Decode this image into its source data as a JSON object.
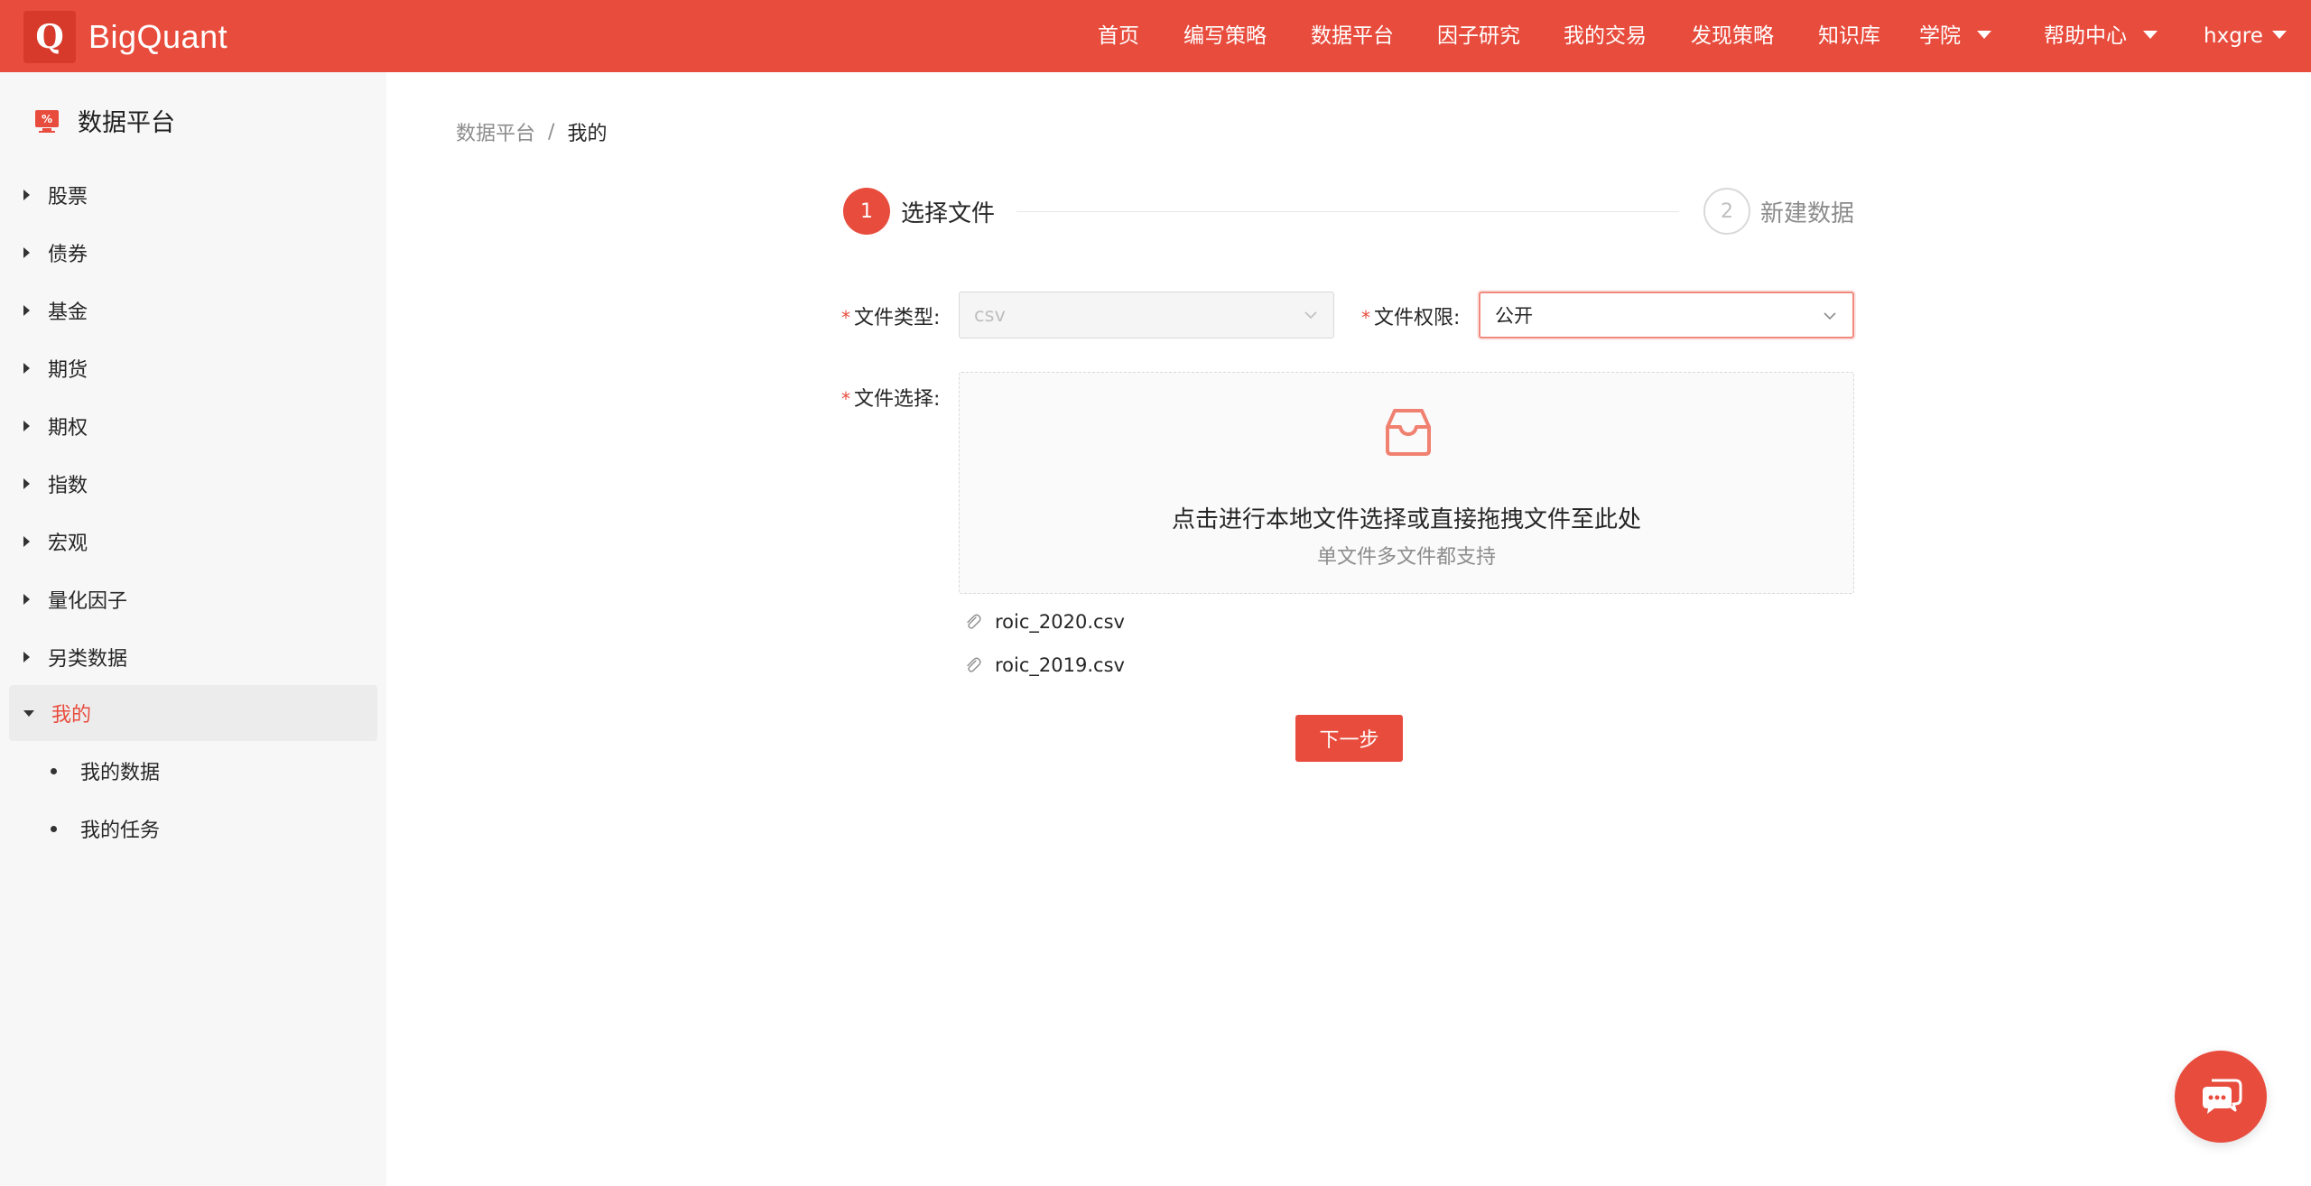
{
  "brand": {
    "logo_letter": "Q",
    "name": "BigQuant"
  },
  "nav": {
    "items": [
      {
        "label": "首页"
      },
      {
        "label": "编写策略"
      },
      {
        "label": "数据平台"
      },
      {
        "label": "因子研究"
      },
      {
        "label": "我的交易"
      },
      {
        "label": "发现策略"
      },
      {
        "label": "知识库"
      },
      {
        "label": "学院",
        "dropdown": true
      },
      {
        "label": "帮助中心",
        "dropdown": true
      },
      {
        "label": "hxgre",
        "dropdown": true
      }
    ]
  },
  "sidebar": {
    "title": "数据平台",
    "items": [
      {
        "label": "股票"
      },
      {
        "label": "债券"
      },
      {
        "label": "基金"
      },
      {
        "label": "期货"
      },
      {
        "label": "期权"
      },
      {
        "label": "指数"
      },
      {
        "label": "宏观"
      },
      {
        "label": "量化因子"
      },
      {
        "label": "另类数据"
      },
      {
        "label": "我的",
        "active": true,
        "expanded": true
      }
    ],
    "sub_items": [
      {
        "label": "我的数据"
      },
      {
        "label": "我的任务"
      }
    ]
  },
  "breadcrumb": {
    "parent": "数据平台",
    "separator": "/",
    "current": "我的"
  },
  "steps": [
    {
      "number": "1",
      "title": "选择文件",
      "status": "current"
    },
    {
      "number": "2",
      "title": "新建数据",
      "status": "pending"
    }
  ],
  "form": {
    "required_mark": "*",
    "file_type": {
      "label": "文件类型:",
      "value": "csv",
      "disabled": true
    },
    "file_permission": {
      "label": "文件权限:",
      "value": "公开"
    },
    "file_select": {
      "label": "文件选择:",
      "dropzone_text": "点击进行本地文件选择或直接拖拽文件至此处",
      "dropzone_hint": "单文件多文件都支持"
    },
    "files": [
      {
        "name": "roic_2020.csv"
      },
      {
        "name": "roic_2019.csv"
      }
    ],
    "next_label": "下一步"
  },
  "colors": {
    "brand": "#e84c3d",
    "sidebar_bg": "#f7f7f7",
    "active_bg": "#ececec"
  },
  "icons": {
    "chat": "chat-bubbles-icon",
    "dropzone": "inbox-icon",
    "file": "paperclip-icon"
  }
}
